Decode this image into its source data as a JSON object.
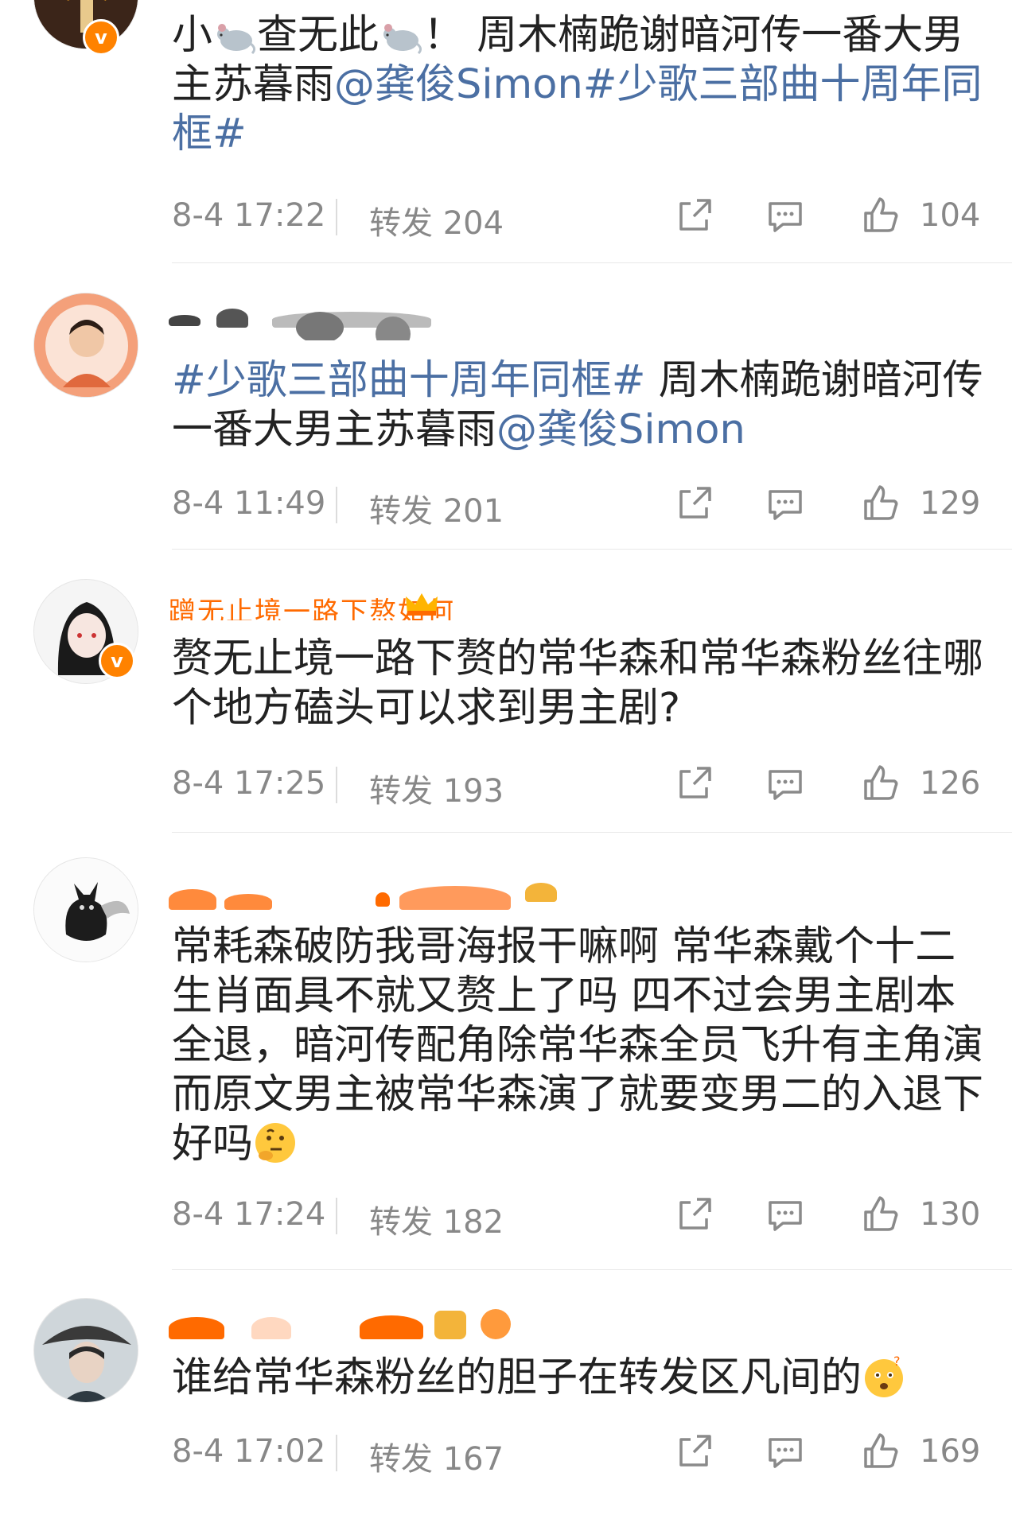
{
  "comments": [
    {
      "text_plain_1": "小",
      "text_plain_2": "查无此",
      "text_plain_3": "！ 周木楠跪谢暗河传一番大男主苏暮雨",
      "mention": "@龚俊Simon",
      "topic": "#少歌三部曲十周年同框#",
      "time": "8-4 17:22",
      "forwards": "转发 204",
      "likes": "104"
    },
    {
      "topic": "#少歌三部曲十周年同框#",
      "text_plain": " 周木楠跪谢暗河传一番大男主苏暮雨",
      "mention": "@龚俊Simon",
      "time": "8-4 11:49",
      "forwards": "转发 201",
      "likes": "129"
    },
    {
      "nickname": "蹭无止境一路下熬如何",
      "text_plain": "赘无止境一路下赘的常华森和常华森粉丝往哪个地方磕头可以求到男主剧?",
      "time": "8-4 17:25",
      "forwards": "转发 193",
      "likes": "126"
    },
    {
      "text_plain": "常耗森破防我哥海报干嘛啊 常华森戴个十二生肖面具不就又赘上了吗 四不过会男主剧本全退，暗河传配角除常华森全员飞升有主角演而原文男主被常华森演了就要变男二的入退下好吗",
      "time": "8-4 17:24",
      "forwards": "转发 182",
      "likes": "130"
    },
    {
      "text_plain": "谁给常华森粉丝的胆子在转发区凡间的",
      "time": "8-4 17:02",
      "forwards": "转发 167",
      "likes": "169"
    }
  ],
  "colors": {
    "link": "#4b6fa3",
    "text": "#222222",
    "meta": "#888888",
    "vip_orange": "#ff8200"
  },
  "icons": [
    "rat-emoji",
    "verified-v-icon",
    "share-icon",
    "comment-icon",
    "thumbs-up-icon",
    "thinking-face-emoji",
    "puzzled-face-emoji",
    "crown-icon"
  ]
}
